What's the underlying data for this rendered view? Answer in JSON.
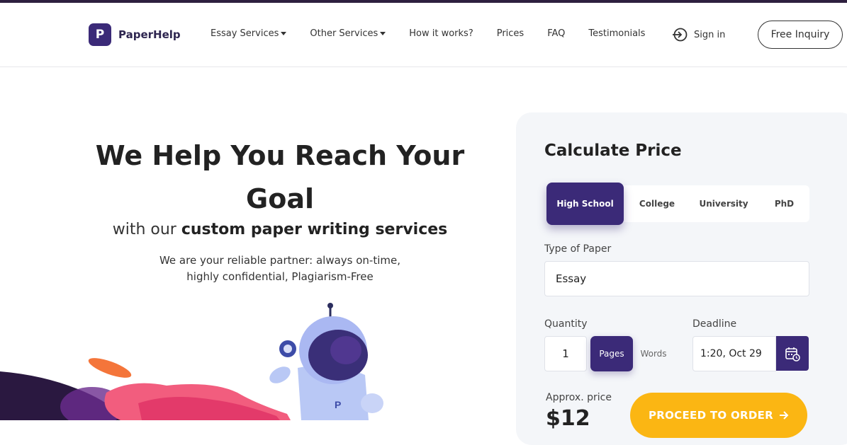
{
  "brand": {
    "logo_letter": "P",
    "name": "PaperHelp",
    "primary_color": "#3b2a78",
    "accent_color": "#fbb613"
  },
  "nav": {
    "items": [
      {
        "label": "Essay Services",
        "dropdown": true
      },
      {
        "label": "Other Services",
        "dropdown": true
      },
      {
        "label": "How it works?",
        "dropdown": false
      },
      {
        "label": "Prices",
        "dropdown": false
      },
      {
        "label": "FAQ",
        "dropdown": false
      },
      {
        "label": "Testimonials",
        "dropdown": false
      }
    ],
    "signin_label": "Sign in",
    "inquiry_label": "Free Inquiry"
  },
  "hero": {
    "title": "We Help You Reach Your Goal",
    "subtitle_prefix": "with our ",
    "subtitle_bold": "custom paper writing services",
    "desc_line1": "We are your reliable partner: always on-time,",
    "desc_line2": "highly confidential, Plagiarism-Free",
    "mascot_badge": "P"
  },
  "calculator": {
    "title": "Calculate Price",
    "levels": [
      "High School",
      "College",
      "University",
      "PhD"
    ],
    "active_level": "High School",
    "type_label": "Type of Paper",
    "type_value": "Essay",
    "quantity_label": "Quantity",
    "quantity_value": "1",
    "unit_pages": "Pages",
    "unit_words": "Words",
    "active_unit": "Pages",
    "deadline_label": "Deadline",
    "deadline_value": "1:20, Oct 29",
    "approx_label": "Approx. price",
    "price_value": "$12",
    "proceed_label": "PROCEED TO ORDER"
  }
}
